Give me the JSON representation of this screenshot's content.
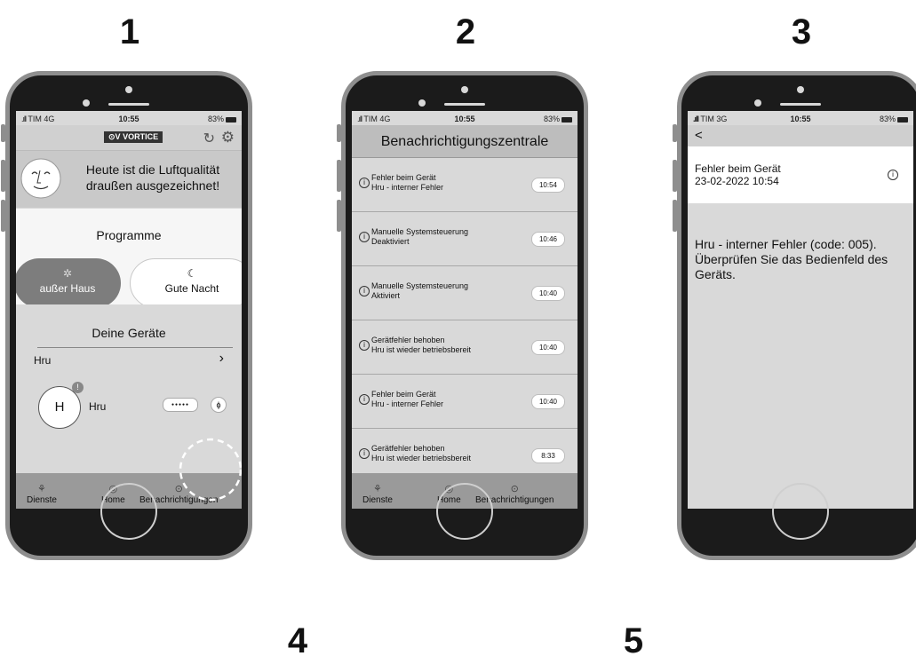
{
  "steps": [
    "1",
    "2",
    "3",
    "4",
    "5"
  ],
  "status": {
    "carrier1": "TIM 4G",
    "carrier3": "TIM 3G",
    "time": "10:55",
    "battery": "83%"
  },
  "screen1": {
    "logo": "VORTICE",
    "logo_mark": "⊙V",
    "refresh_icon": "refresh-icon",
    "settings_icon": "gear-icon",
    "air_quality": "Heute ist die Luftqualität draußen ausgezeichnet!",
    "programs_title": "Programme",
    "program_away": "außer Haus",
    "program_night": "Gute Nacht",
    "devices_title": "Deine Geräte",
    "group_name": "Hru",
    "device_initial": "H",
    "device_badge": "!",
    "device_name": "Hru",
    "device_dots": "●●●●●",
    "device_mode": "ϕ"
  },
  "nav": {
    "services": "Dienste",
    "home": "Home",
    "notifications": "Benachrichtigungen"
  },
  "screen2": {
    "title": "Benachrichtigungszentrale",
    "notifications": [
      {
        "title": "Fehler beim Gerät",
        "detail": "Hru - interner Fehler",
        "time": "10:54"
      },
      {
        "title": "Manuelle Systemsteuerung",
        "detail": "Deaktiviert",
        "time": "10:46"
      },
      {
        "title": "Manuelle Systemsteuerung",
        "detail": "Aktiviert",
        "time": "10:40"
      },
      {
        "title": "Gerätfehler behoben",
        "detail": "Hru ist wieder betriebsbereit",
        "time": "10:40"
      },
      {
        "title": "Fehler beim Gerät",
        "detail": "Hru - interner Fehler",
        "time": "10:40"
      },
      {
        "title": "Gerätfehler behoben",
        "detail": "Hru ist wieder betriebsbereit",
        "time": "8:33"
      }
    ]
  },
  "screen3": {
    "back": "<",
    "header_title": "Fehler beim Gerät",
    "header_date": "23-02-2022 10:54",
    "message": "Hru - interner Fehler (code: 005). Überprüfen Sie das Bedienfeld des Geräts."
  }
}
